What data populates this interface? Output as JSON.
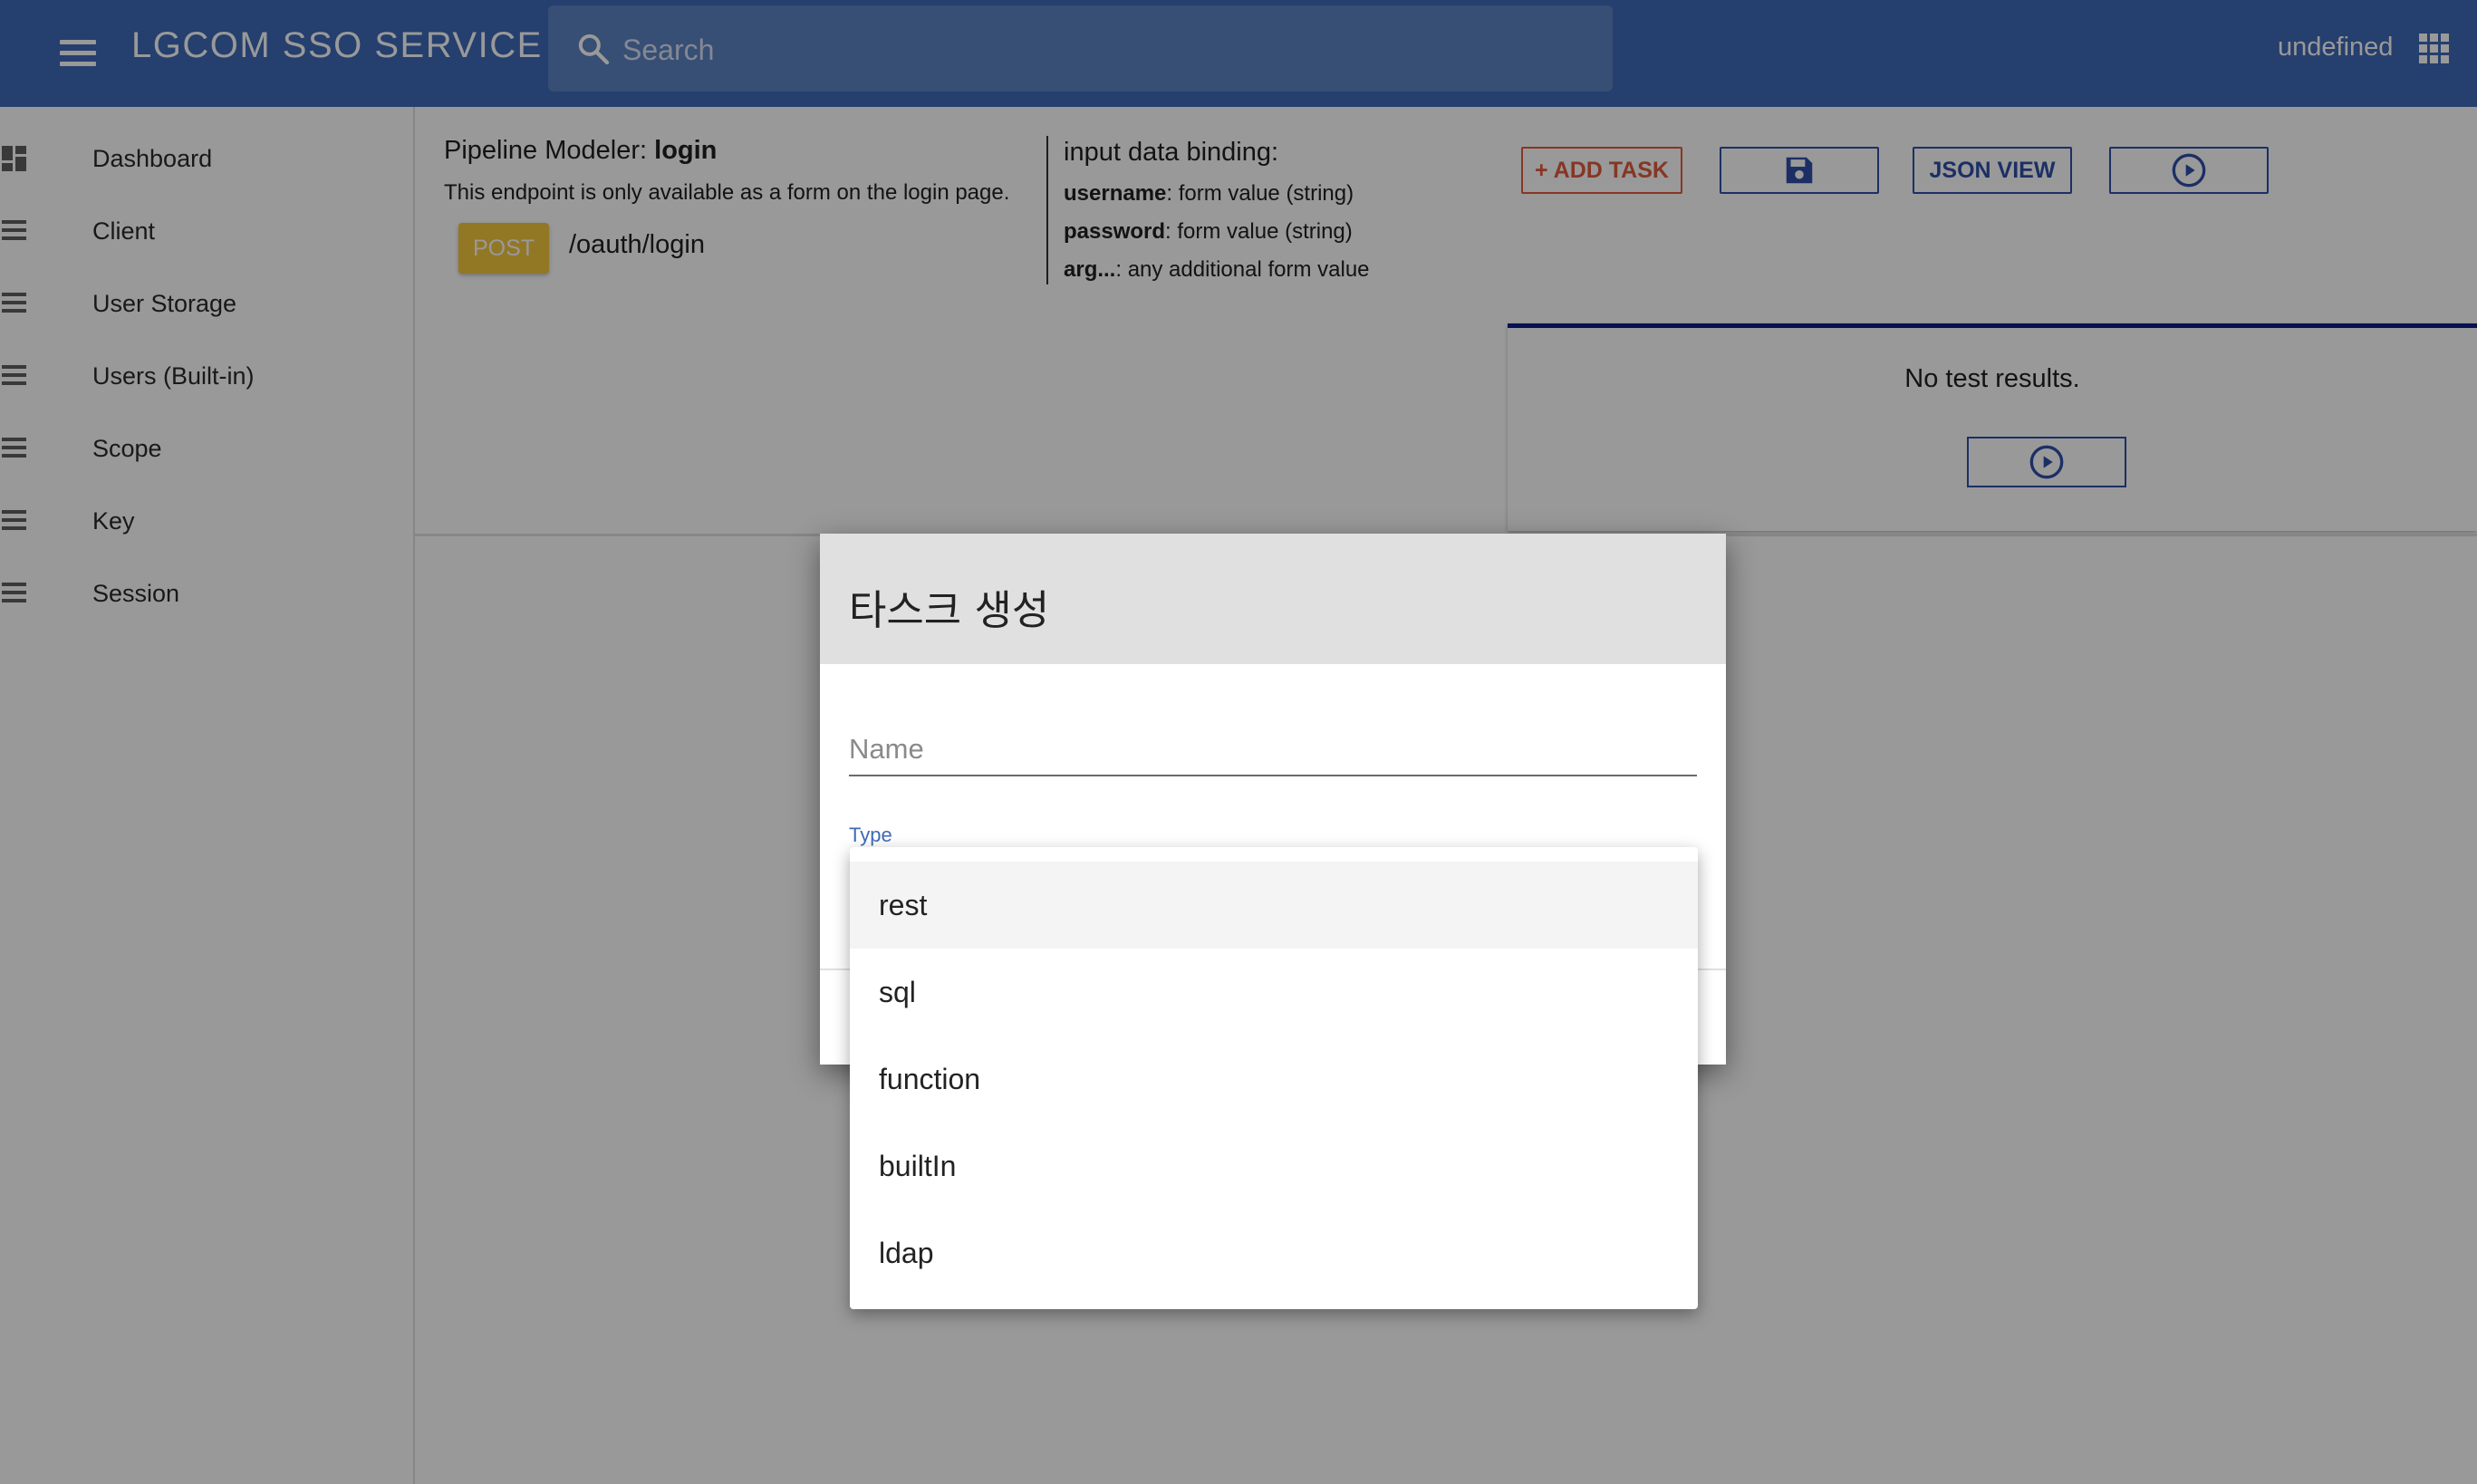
{
  "appbar": {
    "title": "LGCOM SSO SERVICE",
    "search_placeholder": "Search",
    "user": "undefined"
  },
  "sidebar": {
    "items": [
      {
        "label": "Dashboard",
        "icon": "dashboard-icon"
      },
      {
        "label": "Client",
        "icon": "list-icon"
      },
      {
        "label": "User Storage",
        "icon": "list-icon"
      },
      {
        "label": "Users (Built-in)",
        "icon": "list-icon"
      },
      {
        "label": "Scope",
        "icon": "list-icon"
      },
      {
        "label": "Key",
        "icon": "list-icon"
      },
      {
        "label": "Session",
        "icon": "list-icon"
      }
    ]
  },
  "pipeline": {
    "title_prefix": "Pipeline Modeler: ",
    "title_name": "login",
    "description": "This endpoint is only available as a form on the login page.",
    "method": "POST",
    "endpoint": "/oauth/login"
  },
  "binding": {
    "title": "input data binding:",
    "rows": [
      {
        "key": "username",
        "value": ": form value (string)"
      },
      {
        "key": "password",
        "value": ": form value (string)"
      },
      {
        "key": "arg...",
        "value": ": any additional form value"
      }
    ]
  },
  "toolbar": {
    "add_task": "+ ADD TASK",
    "json_view": "JSON VIEW"
  },
  "results": {
    "empty_text": "No test results."
  },
  "dialog": {
    "title": "타스크 생성",
    "name_placeholder": "Name",
    "type_label": "Type",
    "type_options": [
      "rest",
      "sql",
      "function",
      "builtIn",
      "ldap"
    ]
  },
  "colors": {
    "appbar": "#3f6ab8",
    "accent_blue": "#2f4fa8",
    "add_task": "#e25a3c",
    "post_chip": "#f4c73f",
    "results_border": "#0d1d8a"
  }
}
